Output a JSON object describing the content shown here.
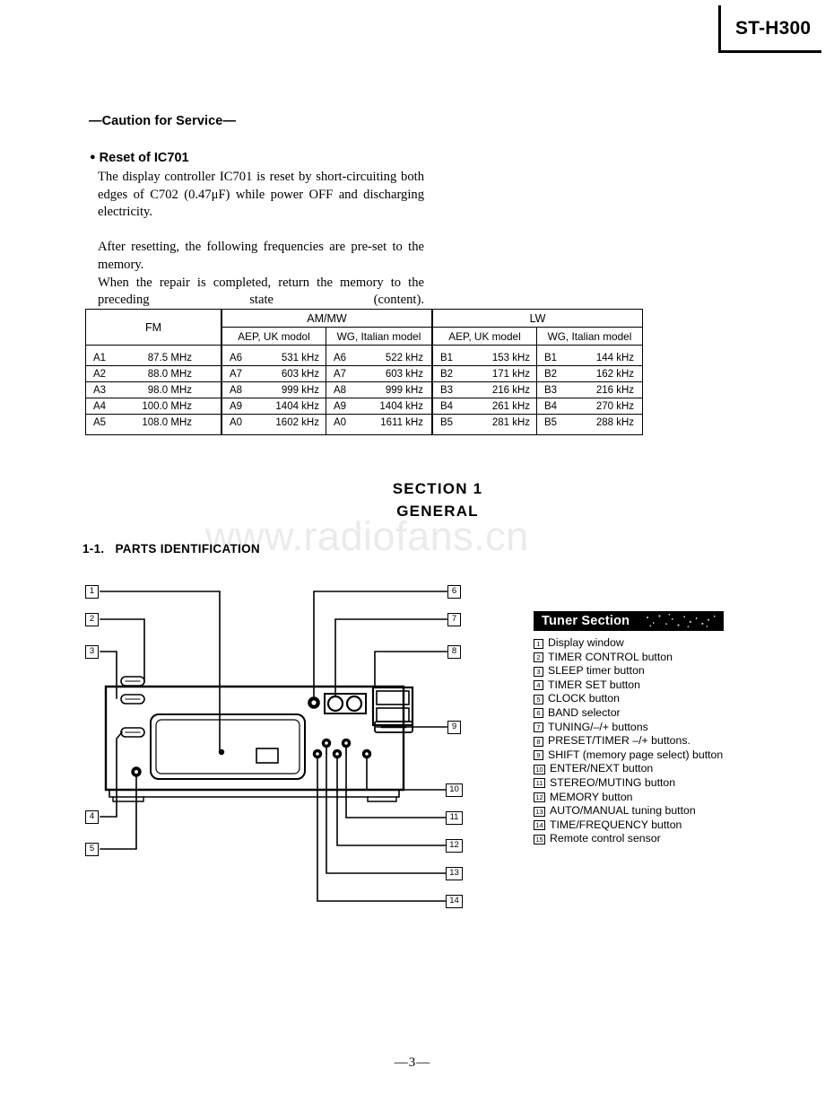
{
  "model": {
    "label": "ST-H300"
  },
  "caution": {
    "heading": "—Caution for Service—",
    "reset_heading": "Reset of IC701",
    "bullet_glyph": "●",
    "paragraphs": [
      "The display controller IC701 is reset by short-circuiting both edges of C702 (0.47μF) while power OFF and discharging electricity.",
      "After resetting, the following frequencies are pre-set to the memory.",
      "When the repair is completed, return the memory to the preceding state (content)."
    ]
  },
  "freq_table": {
    "band_headers": [
      "FM",
      "AM/MW",
      "LW"
    ],
    "model_headers": [
      "AEP, UK modol",
      "WG, Italian model",
      "AEP, UK model",
      "WG, Italian model"
    ],
    "rows": [
      {
        "fm": {
          "ch": "A1",
          "val": "87.5 MHz"
        },
        "am_aep": {
          "ch": "A6",
          "val": "531 kHz"
        },
        "am_wg": {
          "ch": "A6",
          "val": "522 kHz"
        },
        "lw_aep": {
          "ch": "B1",
          "val": "153 kHz"
        },
        "lw_wg": {
          "ch": "B1",
          "val": "144 kHz"
        }
      },
      {
        "fm": {
          "ch": "A2",
          "val": "88.0 MHz"
        },
        "am_aep": {
          "ch": "A7",
          "val": "603 kHz"
        },
        "am_wg": {
          "ch": "A7",
          "val": "603 kHz"
        },
        "lw_aep": {
          "ch": "B2",
          "val": "171 kHz"
        },
        "lw_wg": {
          "ch": "B2",
          "val": "162 kHz"
        }
      },
      {
        "fm": {
          "ch": "A3",
          "val": "98.0 MHz"
        },
        "am_aep": {
          "ch": "A8",
          "val": "999 kHz"
        },
        "am_wg": {
          "ch": "A8",
          "val": "999 kHz"
        },
        "lw_aep": {
          "ch": "B3",
          "val": "216 kHz"
        },
        "lw_wg": {
          "ch": "B3",
          "val": "216 kHz"
        }
      },
      {
        "fm": {
          "ch": "A4",
          "val": "100.0 MHz"
        },
        "am_aep": {
          "ch": "A9",
          "val": "1404 kHz"
        },
        "am_wg": {
          "ch": "A9",
          "val": "1404 kHz"
        },
        "lw_aep": {
          "ch": "B4",
          "val": "261 kHz"
        },
        "lw_wg": {
          "ch": "B4",
          "val": "270 kHz"
        }
      },
      {
        "fm": {
          "ch": "A5",
          "val": "108.0 MHz"
        },
        "am_aep": {
          "ch": "A0",
          "val": "1602 kHz"
        },
        "am_wg": {
          "ch": "A0",
          "val": "1611 kHz"
        },
        "lw_aep": {
          "ch": "B5",
          "val": "281 kHz"
        },
        "lw_wg": {
          "ch": "B5",
          "val": "288 kHz"
        }
      }
    ]
  },
  "section": {
    "number": "SECTION 1",
    "title": "GENERAL",
    "subsection_number": "1-1.",
    "subsection_title": "PARTS IDENTIFICATION"
  },
  "watermark": {
    "text": "www.radiofans.cn",
    "color": "#ebebeb"
  },
  "tuner_panel": {
    "header": "Tuner Section",
    "items": [
      {
        "n": "1",
        "label": "Display window"
      },
      {
        "n": "2",
        "label": "TIMER CONTROL button"
      },
      {
        "n": "3",
        "label": "SLEEP timer button"
      },
      {
        "n": "4",
        "label": "TIMER SET button"
      },
      {
        "n": "5",
        "label": "CLOCK button"
      },
      {
        "n": "6",
        "label": "BAND selector"
      },
      {
        "n": "7",
        "label": "TUNING/–/+ buttons"
      },
      {
        "n": "8",
        "label": "PRESET/TIMER –/+ buttons."
      },
      {
        "n": "9",
        "label": "SHIFT (memory page select) button"
      },
      {
        "n": "10",
        "label": "ENTER/NEXT button"
      },
      {
        "n": "11",
        "label": "STEREO/MUTING button"
      },
      {
        "n": "12",
        "label": "MEMORY button"
      },
      {
        "n": "13",
        "label": "AUTO/MANUAL tuning button"
      },
      {
        "n": "14",
        "label": "TIME/FREQUENCY button"
      },
      {
        "n": "15",
        "label": "Remote control sensor"
      }
    ]
  },
  "diagram": {
    "callouts_left": [
      "1",
      "2",
      "3",
      "4",
      "5"
    ],
    "callouts_right": [
      "6",
      "7",
      "8",
      "9",
      "10",
      "11",
      "12",
      "13",
      "14"
    ]
  },
  "footer": {
    "page": "—3—"
  }
}
